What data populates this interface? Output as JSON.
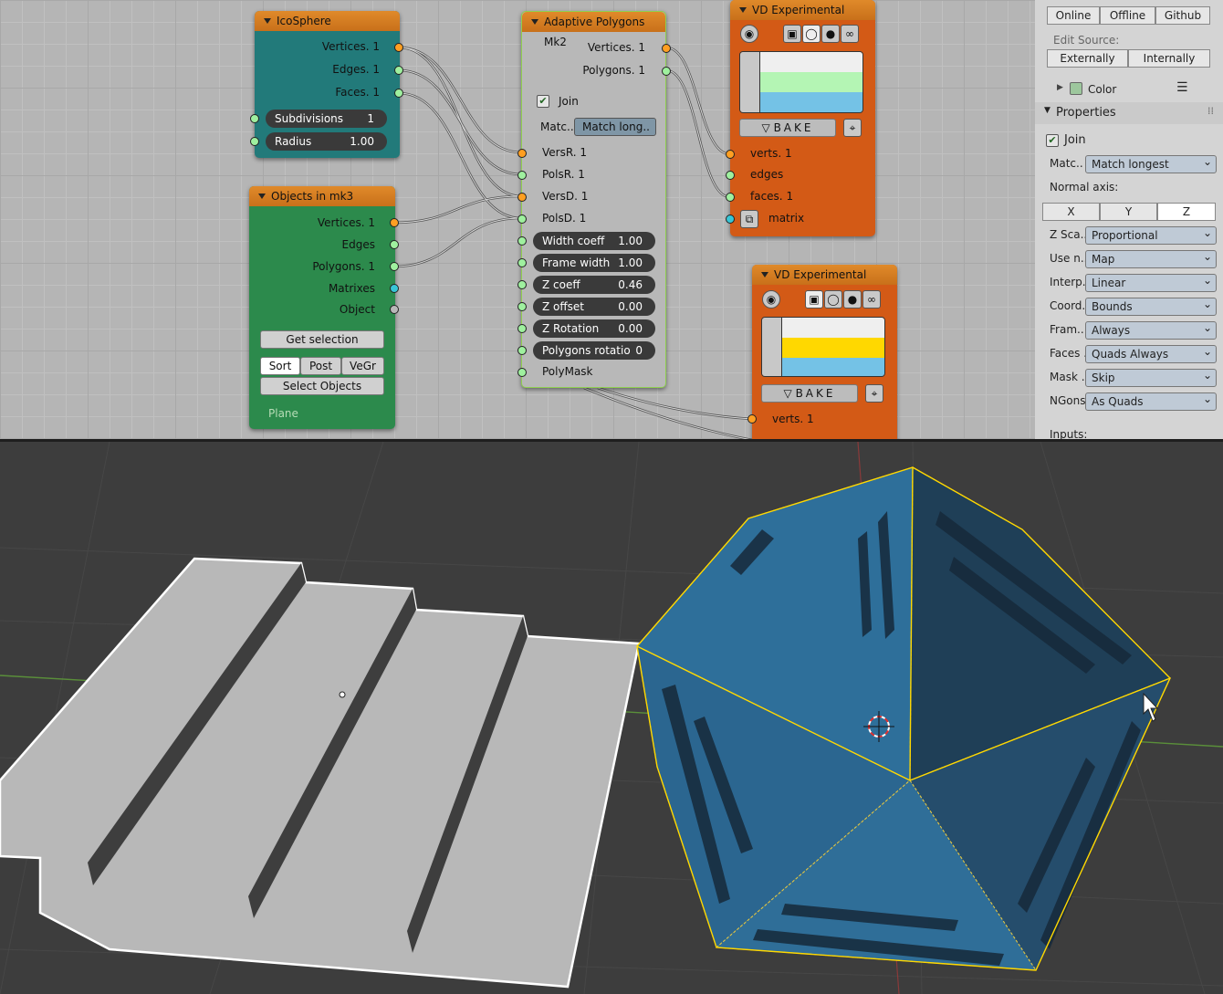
{
  "nodes": {
    "icosphere": {
      "title": "IcoSphere",
      "outputs": [
        "Vertices. 1",
        "Edges. 1",
        "Faces. 1"
      ],
      "subdivisions_label": "Subdivisions",
      "subdivisions_value": "1",
      "radius_label": "Radius",
      "radius_value": "1.00"
    },
    "objects": {
      "title": "Objects in mk3",
      "outputs": [
        "Vertices. 1",
        "Edges",
        "Polygons. 1",
        "Matrixes",
        "Object"
      ],
      "get_selection": "Get selection",
      "sort_tabs": [
        "Sort",
        "Post",
        "VeGr"
      ],
      "select_objects": "Select Objects",
      "object_name": "Plane"
    },
    "adaptive": {
      "title": "Adaptive Polygons Mk2",
      "outputs": [
        "Vertices. 1",
        "Polygons. 1"
      ],
      "join_label": "Join",
      "match_label": "Matc..",
      "match_value": "Match long..",
      "inputs": [
        "VersR. 1",
        "PolsR. 1",
        "VersD. 1",
        "PolsD. 1"
      ],
      "fields": [
        {
          "label": "Width coeff",
          "value": "1.00"
        },
        {
          "label": "Frame width",
          "value": "1.00"
        },
        {
          "label": "Z coeff",
          "value": "0.46"
        },
        {
          "label": "Z offset",
          "value": "0.00"
        },
        {
          "label": "Z Rotation",
          "value": "0.00"
        },
        {
          "label": "Polygons rotatio",
          "value": "0"
        }
      ],
      "polymask": "PolyMask"
    },
    "vd1": {
      "title": "VD Experimental",
      "bake": "BAKE",
      "inputs": [
        "verts. 1",
        "edges",
        "faces. 1",
        "matrix"
      ]
    },
    "vd2": {
      "title": "VD Experimental",
      "bake": "BAKE",
      "inputs": [
        "verts. 1"
      ]
    }
  },
  "swatches": {
    "vd1": [
      "#efefef",
      "#b4f5b4",
      "#74c2e6"
    ],
    "vd2": [
      "#efefef",
      "#ffd800",
      "#74c2e6"
    ]
  },
  "props": {
    "top_buttons": [
      "Online",
      "Offline",
      "Github"
    ],
    "edit_source_label": "Edit Source:",
    "edit_source_buttons": [
      "Externally",
      "Internally"
    ],
    "color_label": "Color",
    "properties_header": "Properties",
    "join_label": "Join",
    "match_label": "Matc..",
    "match_value": "Match longest",
    "normal_axis_label": "Normal axis:",
    "axes": [
      "X",
      "Y",
      "Z"
    ],
    "active_axis": "Z",
    "rows": [
      {
        "label": "Z Sca..",
        "value": "Proportional"
      },
      {
        "label": "Use n..",
        "value": "Map"
      },
      {
        "label": "Interp..",
        "value": "Linear"
      },
      {
        "label": "Coord..",
        "value": "Bounds"
      },
      {
        "label": "Fram..",
        "value": "Always"
      },
      {
        "label": "Faces ..",
        "value": "Quads Always"
      },
      {
        "label": "Mask ..",
        "value": "Skip"
      },
      {
        "label": "NGons:",
        "value": "As Quads"
      }
    ],
    "inputs_label": "Inputs:"
  },
  "colors": {
    "teal": "#227a7a",
    "green": "#2c8a4c",
    "orange": "#d35a16",
    "gray_node": "#b8b8b8",
    "node_header": "#d9801f",
    "mesh_blue": "#2e6f9a",
    "plane": "#b7b7b7"
  }
}
